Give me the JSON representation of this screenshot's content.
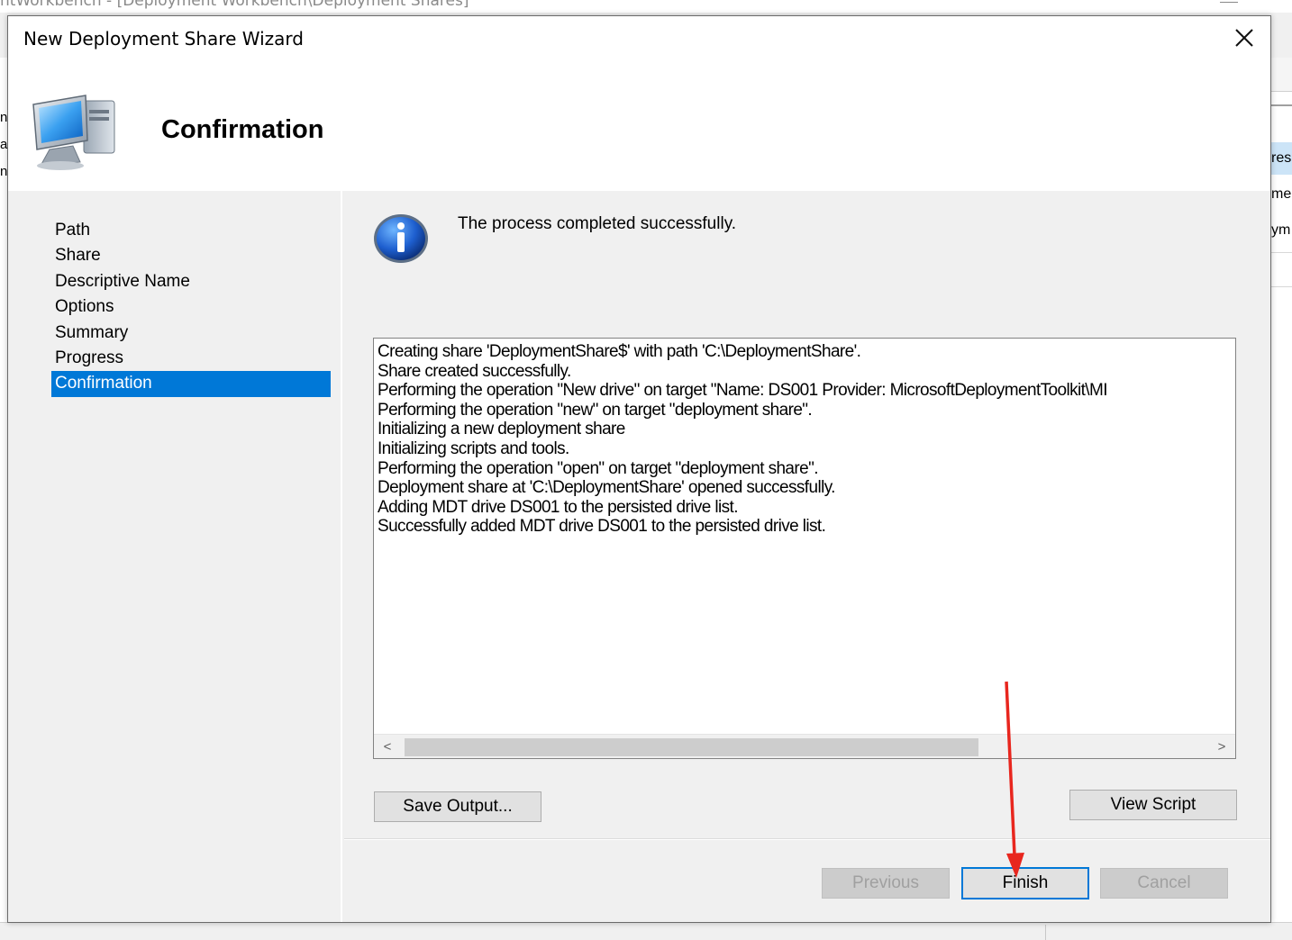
{
  "background_window": {
    "title": "ntWorkbench - [Deployment Workbench\\Deployment Shares]",
    "left_fragments": [
      "n",
      "a",
      "n"
    ],
    "right_items": [
      "res",
      "me",
      "ym"
    ]
  },
  "dialog": {
    "title": "New Deployment Share Wizard",
    "close_label": "✕"
  },
  "header": {
    "title": "Confirmation",
    "icon": "computer-icon"
  },
  "nav": {
    "items": [
      {
        "label": "Path",
        "active": false
      },
      {
        "label": "Share",
        "active": false
      },
      {
        "label": "Descriptive Name",
        "active": false
      },
      {
        "label": "Options",
        "active": false
      },
      {
        "label": "Summary",
        "active": false
      },
      {
        "label": "Progress",
        "active": false
      },
      {
        "label": "Confirmation",
        "active": true
      }
    ]
  },
  "content": {
    "info_icon": "info-icon",
    "status_message": "The process completed successfully.",
    "log_lines": [
      "Creating share 'DeploymentShare$' with path 'C:\\DeploymentShare'.",
      "Share created successfully.",
      "Performing the operation \"New drive\" on target \"Name: DS001 Provider: MicrosoftDeploymentToolkit\\MI",
      "Performing the operation \"new\" on target \"deployment share\".",
      "Initializing a new deployment share",
      "Initializing scripts and tools.",
      "Performing the operation \"open\" on target \"deployment share\".",
      "Deployment share at 'C:\\DeploymentShare' opened successfully.",
      "Adding MDT drive DS001 to the persisted drive list.",
      "Successfully added MDT drive DS001 to the persisted drive list."
    ],
    "scroll_left_label": "<",
    "scroll_right_label": ">"
  },
  "buttons": {
    "save_output": "Save Output...",
    "view_script": "View Script",
    "previous": "Previous",
    "finish": "Finish",
    "cancel": "Cancel"
  },
  "colors": {
    "selection": "#0078d7",
    "annotation_arrow": "#e8261e"
  }
}
